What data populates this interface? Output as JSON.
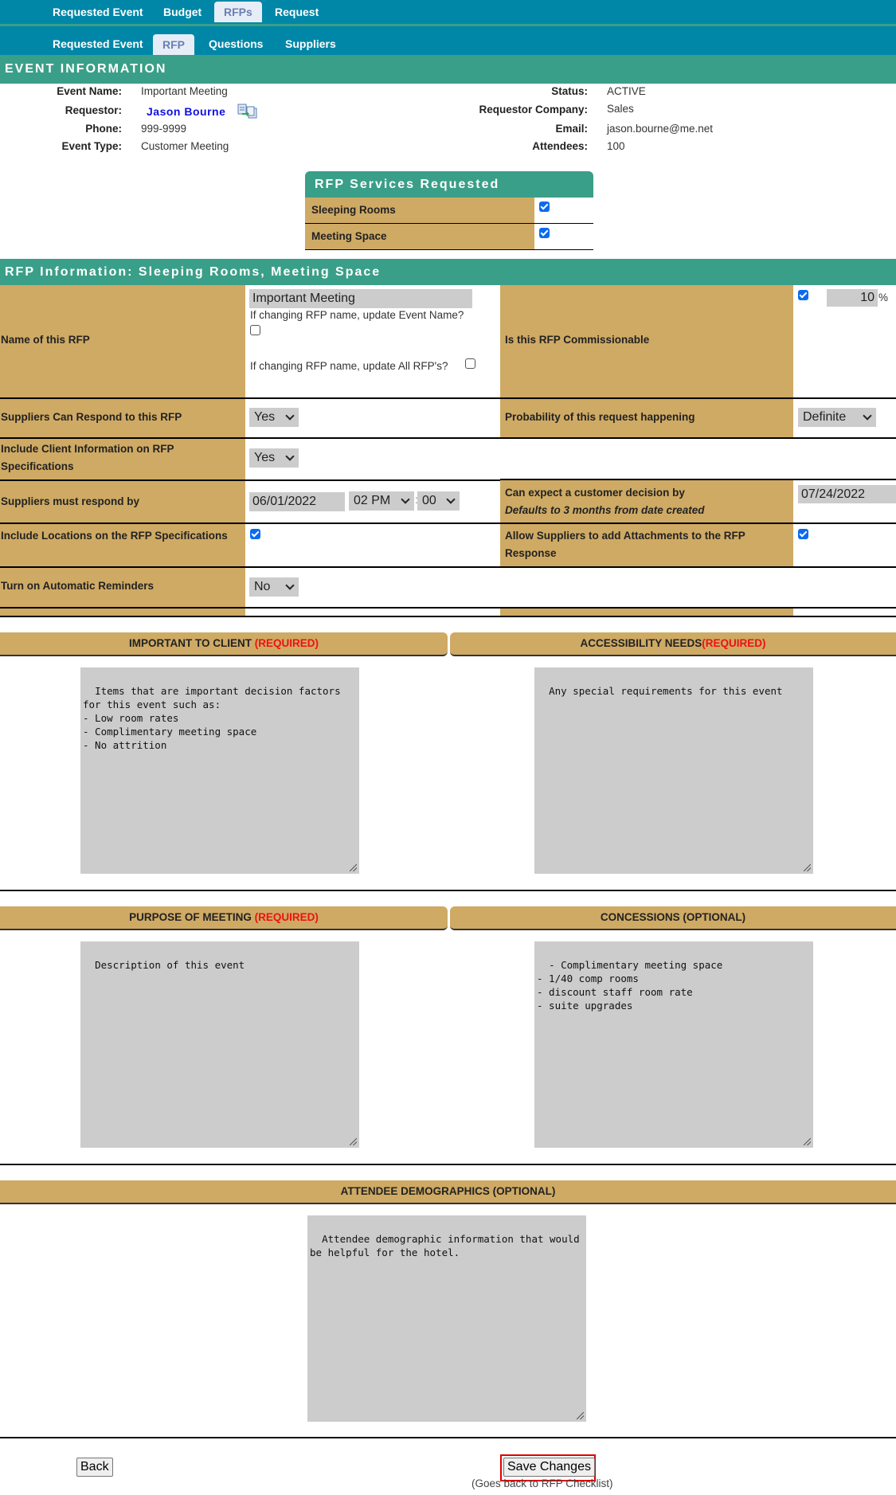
{
  "nav": {
    "primary_tabs": [
      {
        "label": "Requested Event",
        "active": false
      },
      {
        "label": "Budget",
        "active": false
      },
      {
        "label": "RFPs",
        "active": true
      },
      {
        "label": "Request",
        "active": false
      }
    ],
    "secondary_tabs": [
      {
        "label": "Requested Event",
        "active": false
      },
      {
        "label": "RFP",
        "active": true
      },
      {
        "label": "Questions",
        "active": false
      },
      {
        "label": "Suppliers",
        "active": false
      }
    ]
  },
  "event_info": {
    "title": "EVENT INFORMATION",
    "left": [
      {
        "label": "Event Name:",
        "value": "Important Meeting"
      },
      {
        "label": "Requestor:",
        "value": "Jason Bourne",
        "icon": "copy-contact-icon"
      },
      {
        "label": "Phone:",
        "value": "999-9999"
      },
      {
        "label": "Event Type:",
        "value": "Customer Meeting"
      }
    ],
    "right": [
      {
        "label": "Status:",
        "value": "ACTIVE"
      },
      {
        "label": "Requestor Company:",
        "value": "Sales"
      },
      {
        "label": "Email:",
        "value": "jason.bourne@me.net"
      },
      {
        "label": "Attendees:",
        "value": "100"
      }
    ]
  },
  "services": {
    "title": "RFP Services Requested",
    "items": [
      {
        "label": "Sleeping Rooms",
        "checked": true
      },
      {
        "label": "Meeting Space",
        "checked": true
      }
    ]
  },
  "rfp_info": {
    "title": "RFP Information: Sleeping Rooms, Meeting Space",
    "name_label": "Name of this RFP",
    "name_value": "Important Meeting",
    "update_event_name_label": "If changing RFP name, update Event Name?",
    "update_event_name_checked": false,
    "update_all_label": "If changing RFP name, update All RFP's?",
    "update_all_checked": false,
    "commissionable_label": "Is this RFP Commissionable",
    "commissionable_checked": true,
    "commission_value": "10",
    "commission_unit": "%",
    "suppliers_respond_label": "Suppliers Can Respond to this RFP",
    "suppliers_respond_value": "Yes",
    "probability_label": "Probability of this request happening",
    "probability_value": "Definite",
    "include_client_label": "Include Client Information on RFP Specifications",
    "include_client_value": "Yes",
    "respond_by_label": "Suppliers must respond by",
    "respond_by_date": "06/01/2022",
    "respond_by_hour": "02 PM",
    "respond_by_sep": ":",
    "respond_by_minute": "00",
    "decision_label": "Can expect a customer decision by",
    "decision_note": "Defaults to 3 months from date created",
    "decision_date": "07/24/2022",
    "include_locations_label": "Include Locations on the RFP Specifications",
    "include_locations_checked": true,
    "allow_attachments_label": "Allow Suppliers to add Attachments to the RFP Response",
    "allow_attachments_checked": true,
    "reminders_label": "Turn on Automatic Reminders",
    "reminders_value": "No"
  },
  "sections": {
    "important": {
      "title": "IMPORTANT TO CLIENT",
      "tag": "(REQUIRED)",
      "text": "Items that are important decision factors\nfor this event such as:\n- Low room rates\n- Complimentary meeting space\n- No attrition"
    },
    "accessibility": {
      "title": "ACCESSIBILITY NEEDS",
      "tag": "(REQUIRED)",
      "text": "Any special requirements for this event"
    },
    "purpose": {
      "title": "PURPOSE OF MEETING",
      "tag": "(REQUIRED)",
      "text": "Description of this event"
    },
    "concessions": {
      "title": "CONCESSIONS",
      "tag": "(OPTIONAL)",
      "text": "- Complimentary meeting space\n- 1/40 comp rooms\n- discount staff room rate\n- suite upgrades"
    },
    "demographics": {
      "title": "ATTENDEE DEMOGRAPHICS",
      "tag": "(OPTIONAL)",
      "text": "Attendee demographic information that would\nbe helpful for the hotel."
    }
  },
  "footer": {
    "back_label": "Back",
    "save_label": "Save Changes",
    "save_note": "(Goes back to RFP Checklist)"
  },
  "colors": {
    "nav_blue": "#0087a8",
    "teal": "#3a9f88",
    "tan": "#cfaa64",
    "required_red": "#ee1111",
    "link_blue": "#1010e0"
  }
}
